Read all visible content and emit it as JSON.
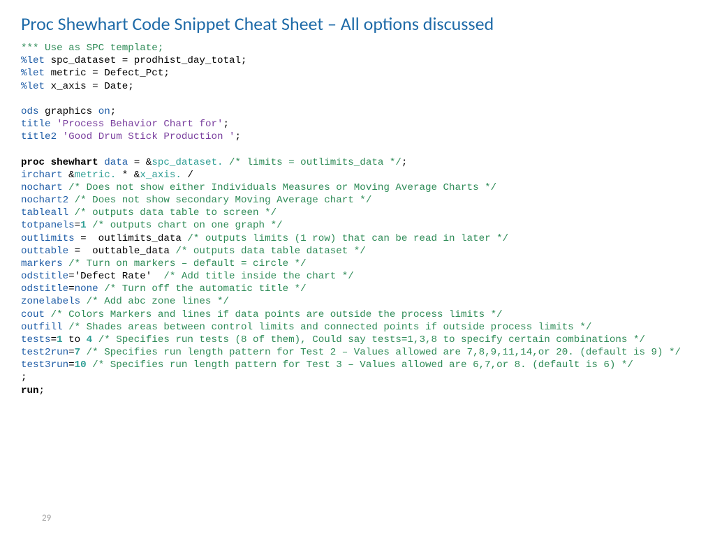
{
  "title": "Proc Shewhart Code Snippet Cheat Sheet – All options discussed",
  "page_number": "29",
  "code": {
    "l1": "*** Use as SPC template;",
    "l2a": "%let",
    "l2b": " spc_dataset = prodhist_day_total;",
    "l3a": "%let",
    "l3b": " metric = Defect_Pct;",
    "l4a": "%let",
    "l4b": " x_axis = Date;",
    "l5a": "ods",
    "l5b": " graphics ",
    "l5c": "on",
    "l5d": ";",
    "l6a": "title",
    "l6b": " 'Process Behavior Chart for'",
    "l6c": ";",
    "l7a": "title2",
    "l7b": " 'Good Drum Stick Production '",
    "l7c": ";",
    "l8a": "proc",
    "l8b": " shewhart",
    "l8c": " data",
    "l8d": " = &",
    "l8e": "spc_dataset.",
    "l8f": " /* limits = outlimits_data */",
    "l8g": ";",
    "l9a": "irchart",
    "l9b": " &",
    "l9c": "metric.",
    "l9d": " * &",
    "l9e": "x_axis.",
    "l9f": " /",
    "l10a": "nochart",
    "l10b": " /* Does not show either Individuals Measures or Moving Average Charts */",
    "l11a": "nochart2",
    "l11b": " /* Does not show secondary Moving Average chart */",
    "l12a": "tableall",
    "l12b": " /* outputs data table to screen */",
    "l13a": "totpanels",
    "l13b": "=",
    "l13c": "1",
    "l13d": " /* outputs chart on one graph */",
    "l14a": "outlimits",
    "l14b": " =  outlimits_data ",
    "l14c": "/* outputs limits (1 row) that can be read in later */",
    "l15a": "outtable",
    "l15b": " =  outtable_data ",
    "l15c": "/* outputs data table dataset */",
    "l16a": "markers",
    "l16b": " /* Turn on markers – default = circle */",
    "l17a": "odstitle",
    "l17b": "='Defect Rate' ",
    "l17c": " /* Add title inside the chart */",
    "l18a": "odstitle",
    "l18b": "=",
    "l18c": "none",
    "l18d": " /* Turn off the automatic title */",
    "l19a": "zonelabels",
    "l19b": " /* Add abc zone lines */",
    "l20a": "cout",
    "l20b": " /* Colors Markers and lines if data points are outside the process limits */",
    "l21a": "outfill",
    "l21b": " /* Shades areas between control limits and connected points if outside process limits */",
    "l22a": "tests",
    "l22b": "=",
    "l22c": "1",
    "l22d": " to ",
    "l22e": "4",
    "l22f": " /* Specifies run tests (8 of them), Could say tests=1,3,8 to specify certain combinations */",
    "l23a": "test2run",
    "l23b": "=",
    "l23c": "7",
    "l23d": " /* Specifies run length pattern for Test 2 – Values allowed are 7,8,9,11,14,or 20. (default is 9) */",
    "l24a": "test3run",
    "l24b": "=",
    "l24c": "10",
    "l24d": " /* Specifies run length pattern for Test 3 – Values allowed are 6,7,or 8. (default is 6) */",
    "l25": ";",
    "l26a": "run",
    "l26b": ";"
  }
}
